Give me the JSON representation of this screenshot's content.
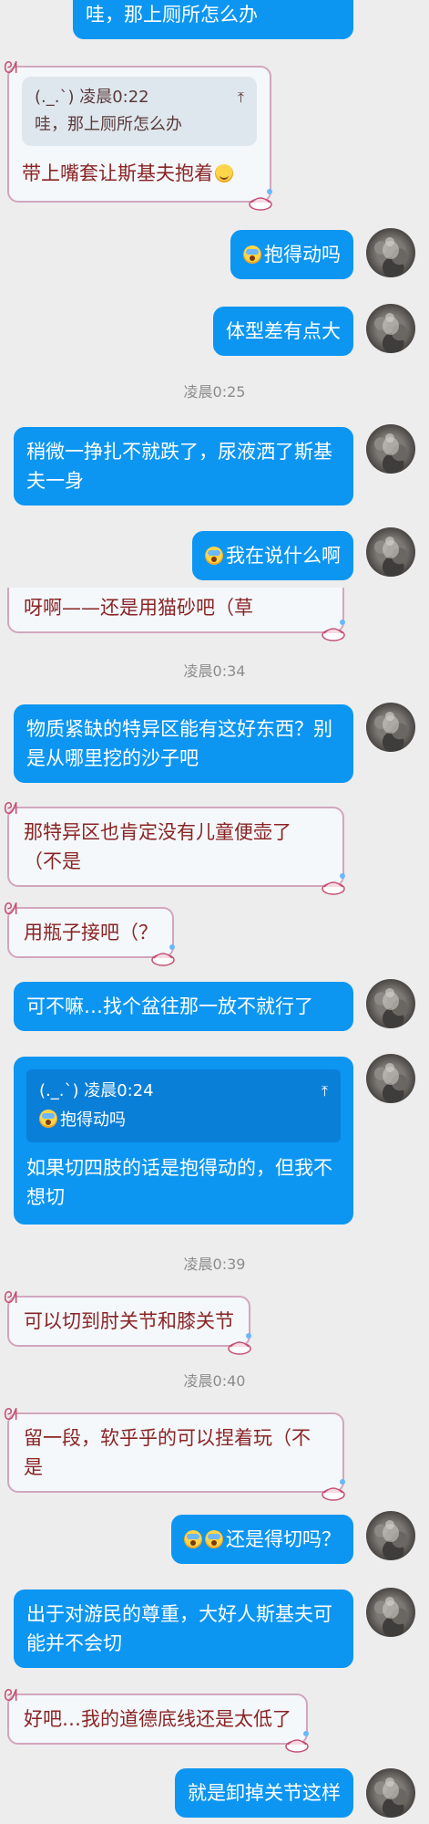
{
  "messages": {
    "m1": "哇，那上厕所怎么办",
    "m2_quote_sender": "(._.`) 凌晨0:22",
    "m2_quote_text": "哇，那上厕所怎么办",
    "m2": "带上嘴套让斯基夫抱着",
    "m3": "抱得动吗",
    "m4": "体型差有点大",
    "t1": "凌晨0:25",
    "m5": "稍微一挣扎不就跌了，尿液洒了斯基夫一身",
    "m6": "我在说什么啊",
    "m7": "呀啊——还是用猫砂吧（草",
    "t2": "凌晨0:34",
    "m8": "物质紧缺的特异区能有这好东西？别是从哪里挖的沙子吧",
    "m9": "那特异区也肯定没有儿童便壶了（不是",
    "m10": "用瓶子接吧（？",
    "m11": "可不嘛…找个盆往那一放不就行了",
    "m12_quote_sender": "(._.`) 凌晨0:24",
    "m12_quote_text": "抱得动吗",
    "m12": "如果切四肢的话是抱得动的，但我不想切",
    "t3": "凌晨0:39",
    "m13": "可以切到肘关节和膝关节",
    "t4": "凌晨0:40",
    "m14": "留一段，软乎乎的可以捏着玩（不是",
    "m15": "还是得切吗？",
    "m16": "出于对游民的尊重，大好人斯基夫可能并不会切",
    "m17": "好吧…我的道德底线还是太低了",
    "m18": "就是卸掉关节这样"
  },
  "icons": {
    "quote_arrow": "arrow-up-to-line-icon",
    "emoji_scream": "face-screaming-icon",
    "emoji_smile": "face-smiling-icon",
    "bubble_decoration": "teapot-sticker-icon"
  },
  "colors": {
    "self_bubble": "#0c96f2",
    "other_bubble_bg": "#f4f8fb",
    "other_text": "#8a2424",
    "background": "#ededed"
  }
}
